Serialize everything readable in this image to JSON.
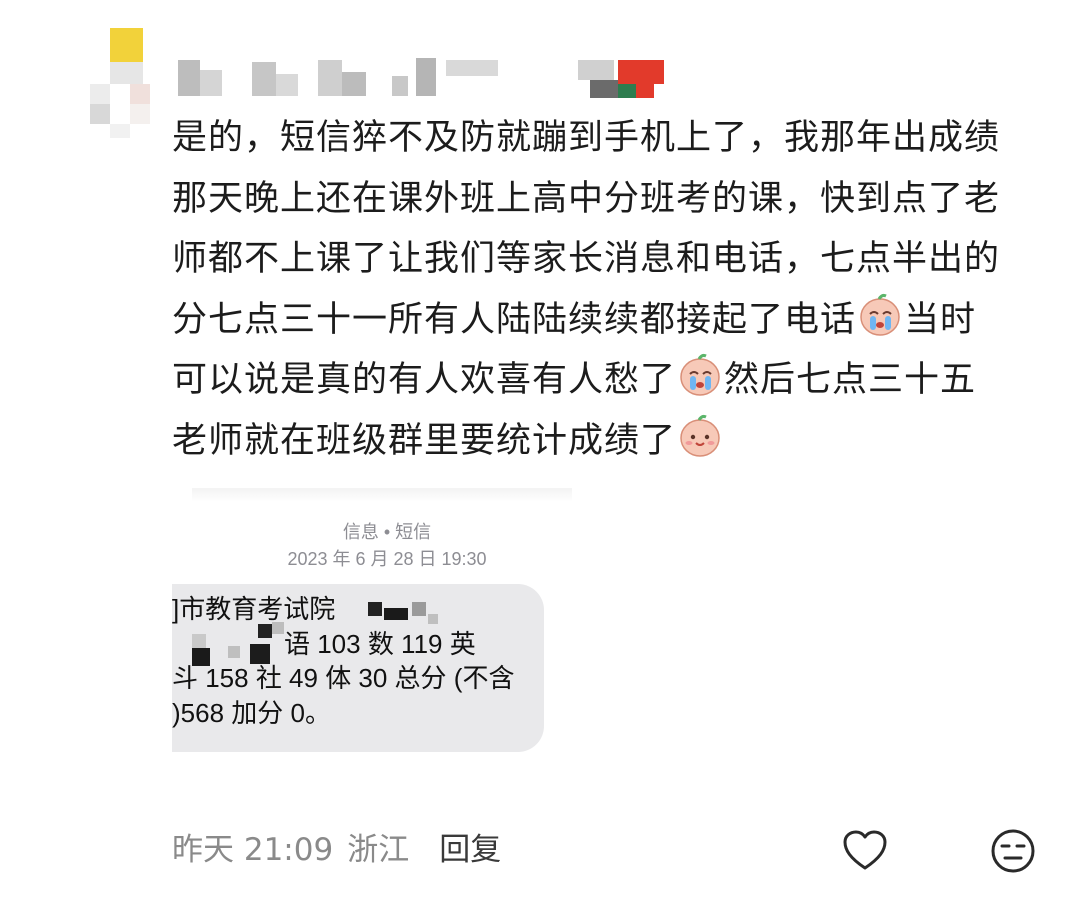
{
  "comment": {
    "lines": [
      "是的，短信猝不及防就蹦到手机上了，我那年出成绩",
      "那天晚上还在课外班上高中分班考的课，快到点了老",
      "师都不上课了让我们等家长消息和电话，七点半出的",
      "分七点三十一所有人陆陆续续都接起了电话",
      "当时",
      "可以说是真的有人欢喜有人愁了",
      "然后七点三十五",
      "老师就在班级群里要统计成绩了"
    ]
  },
  "sms": {
    "app_label": "信息 • 短信",
    "timestamp": "2023 年 6 月 28 日 19:30",
    "lines": [
      "]市教育考试院",
      "语 103 数 119 英",
      "斗 158 社 49 体 30 总分 (不含",
      ")568 加分 0。"
    ]
  },
  "footer": {
    "time": "昨天 21:09",
    "location": "浙江",
    "reply_label": "回复"
  },
  "icons": {
    "like": "heart-icon",
    "emoji_picker": "emoji-face-icon",
    "inline_emoji": "crying-emoji-icon",
    "smile_emoji": "smiling-emoji-icon"
  }
}
